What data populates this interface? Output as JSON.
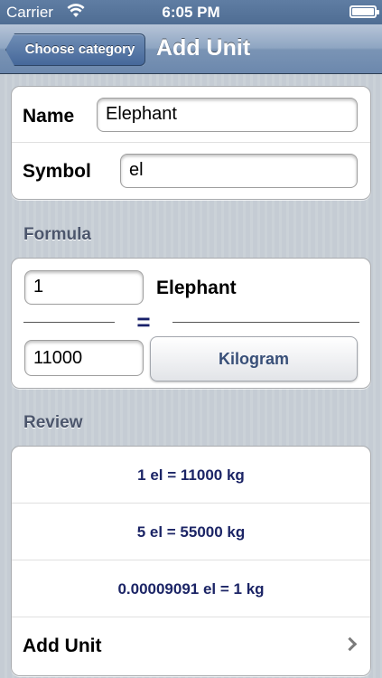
{
  "status_bar": {
    "carrier": "Carrier",
    "time": "6:05 PM",
    "icons": [
      "wifi-icon",
      "battery-icon"
    ]
  },
  "nav": {
    "back_label": "Choose category",
    "title": "Add Unit"
  },
  "unit": {
    "name_label": "Name",
    "name_value": "Elephant",
    "symbol_label": "Symbol",
    "symbol_value": "el"
  },
  "formula": {
    "header": "Formula",
    "from_amount": "1",
    "from_unit": "Elephant",
    "equals": "=",
    "to_amount": "11000",
    "to_unit_button": "Kilogram"
  },
  "review": {
    "header": "Review",
    "lines": [
      "1 el = 11000 kg",
      "5 el = 55000 kg",
      "0.00009091 el = 1 kg"
    ],
    "action_label": "Add Unit"
  },
  "colors": {
    "status_bar": "#56749a",
    "nav_accent": "#6c88ad",
    "review_text": "#1c2566",
    "section_header": "#4c566c"
  }
}
